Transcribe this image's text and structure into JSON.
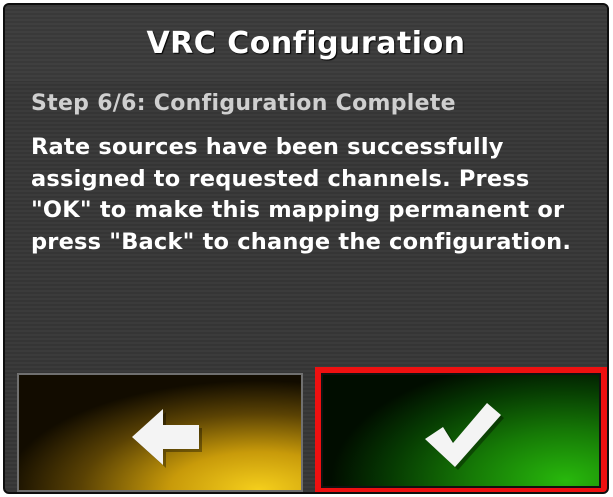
{
  "dialog": {
    "title": "VRC Configuration",
    "step": "Step 6/6: Configuration Complete",
    "message": "Rate sources have been successfully assigned to requested channels. Press \"OK\" to make this mapping permanent or press \"Back\" to change the configuration."
  },
  "buttons": {
    "back_icon": "arrow-left-icon",
    "ok_icon": "checkmark-icon"
  },
  "colors": {
    "back_button": "#f5cf1c",
    "ok_button": "#28b80c",
    "highlight_border": "#ee1010"
  }
}
